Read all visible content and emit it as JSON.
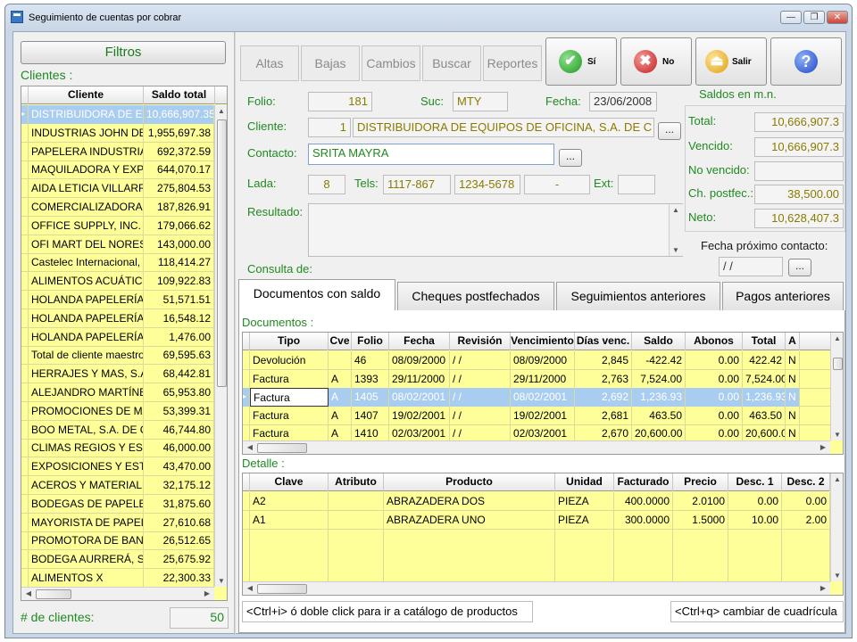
{
  "window": {
    "title": "Seguimiento de cuentas por cobrar",
    "min": "—",
    "max": "❐",
    "close": "✕"
  },
  "left": {
    "filtros": "Filtros",
    "clientes_label": "Clientes :",
    "headers": [
      "Cliente",
      "Saldo total"
    ],
    "rows": [
      [
        "DISTRIBUIDORA DE EQUIP",
        "10,666,907.35"
      ],
      [
        "INDUSTRIAS JOHN DEERE",
        "1,955,697.38"
      ],
      [
        "PAPELERA INDUSTRIAL, S",
        "692,372.59"
      ],
      [
        "MAQUILADORA Y EXPORT",
        "644,070.17"
      ],
      [
        "AIDA LETICIA VILLARREAL",
        "275,804.53"
      ],
      [
        "COMERCIALIZADORA DE",
        "187,826.91"
      ],
      [
        "OFFICE SUPPLY, INC.",
        "179,066.62"
      ],
      [
        "OFI MART DEL NORESTE,",
        "143,000.00"
      ],
      [
        "Castelec Internacional, S.A.",
        "118,414.27"
      ],
      [
        "ALIMENTOS ACUÁTICOS",
        "109,922.83"
      ],
      [
        "HOLANDA PAPELERÍAS C",
        "51,571.51"
      ],
      [
        "HOLANDA PAPELERÍAS D",
        "16,548.12"
      ],
      [
        "HOLANDA PAPELERÍAS D",
        "1,476.00"
      ],
      [
        "Total de cliente maestro HO",
        "69,595.63"
      ],
      [
        "HERRAJES Y MAS, S.A. D",
        "68,442.81"
      ],
      [
        "ALEJANDRO MARTÍNEZ S",
        "65,953.80"
      ],
      [
        "PROMOCIONES DE MADE",
        "53,399.31"
      ],
      [
        "BOO METAL, S.A. DE C.V.",
        "46,744.80"
      ],
      [
        "CLIMAS REGIOS Y ESPEC",
        "46,000.00"
      ],
      [
        "EXPOSICIONES Y ESTANT",
        "43,470.00"
      ],
      [
        "ACEROS Y MATERIALES C",
        "32,175.12"
      ],
      [
        "BODEGAS DE PAPELES Y",
        "31,875.60"
      ],
      [
        "MAYORISTA DE PAPELES",
        "27,610.68"
      ],
      [
        "PROMOTORA DE BANDAS",
        "26,512.65"
      ],
      [
        "BODEGA AURRERÁ, S.A.",
        "25,675.92"
      ],
      [
        "ALIMENTOS X",
        "22,300.33"
      ]
    ],
    "num_clientes_label": "# de clientes:",
    "num_clientes": "50"
  },
  "toolbar": {
    "altas": "Altas",
    "bajas": "Bajas",
    "cambios": "Cambios",
    "buscar": "Buscar",
    "reportes": "Reportes",
    "si": "Sí",
    "no": "No",
    "salir": "Salir",
    "si_icon": "✔",
    "no_icon": "✖",
    "salir_icon": "⏏",
    "help_icon": "?"
  },
  "form": {
    "folio_label": "Folio:",
    "folio": "181",
    "suc_label": "Suc:",
    "suc": "MTY",
    "fecha_label": "Fecha:",
    "fecha": "23/06/2008",
    "cliente_label": "Cliente:",
    "cliente_num": "1",
    "cliente_name": "DISTRIBUIDORA DE EQUIPOS DE OFICINA, S.A. DE C",
    "contacto_label": "Contacto:",
    "contacto": "SRITA MAYRA",
    "lada_label": "Lada:",
    "lada": "8",
    "tels_label": "Tels:",
    "tel1": "1117-867",
    "tel2": "1234-5678",
    "tel3": "-",
    "ext_label": "Ext:",
    "ext": "",
    "resultado_label": "Resultado:",
    "resultado": "",
    "consulta_label": "Consulta de:",
    "ellipsis": "..."
  },
  "saldos": {
    "title": "Saldos en m.n.",
    "total_label": "Total:",
    "total": "10,666,907.3",
    "vencido_label": "Vencido:",
    "vencido": "10,666,907.3",
    "novencido_label": "No vencido:",
    "novencido": "",
    "postfec_label": "Ch. postfec.:",
    "postfec": "38,500.00",
    "neto_label": "Neto:",
    "neto": "10,628,407.3",
    "fpc_label": "Fecha próximo contacto:",
    "fpc": " /  /"
  },
  "tabs": [
    "Documentos con saldo",
    "Cheques postfechados",
    "Seguimientos anteriores",
    "Pagos anteriores"
  ],
  "documentos": {
    "label": "Documentos :",
    "headers": [
      "Tipo",
      "Cve",
      "Folio",
      "Fecha",
      "Revisión",
      "Vencimiento",
      "Días venc.",
      "Saldo",
      "Abonos",
      "Total",
      "A"
    ],
    "rows": [
      [
        "Devolución",
        "",
        "46",
        "08/09/2000",
        " /  /",
        "08/09/2000",
        "2,845",
        "-422.42",
        "0.00",
        "422.42",
        "N"
      ],
      [
        "Factura",
        "A",
        "1393",
        "29/11/2000",
        " /  /",
        "29/11/2000",
        "2,763",
        "7,524.00",
        "0.00",
        "7,524.00",
        "N"
      ],
      [
        "Factura",
        "A",
        "1405",
        "08/02/2001",
        " /  /",
        "08/02/2001",
        "2,692",
        "1,236.93",
        "0.00",
        "1,236.93",
        "N"
      ],
      [
        "Factura",
        "A",
        "1407",
        "19/02/2001",
        " /  /",
        "19/02/2001",
        "2,681",
        "463.50",
        "0.00",
        "463.50",
        "N"
      ],
      [
        "Factura",
        "A",
        "1410",
        "02/03/2001",
        " /  /",
        "02/03/2001",
        "2,670",
        "20,600.00",
        "0.00",
        "20,600.00",
        "N"
      ]
    ]
  },
  "detalle": {
    "label": "Detalle :",
    "headers": [
      "Clave",
      "Atributo",
      "Producto",
      "Unidad",
      "Facturado",
      "Precio",
      "Desc. 1",
      "Desc. 2"
    ],
    "rows": [
      [
        "A2",
        "",
        "ABRAZADERA DOS",
        "PIEZA",
        "400.0000",
        "2.0100",
        "0.00",
        "0.00"
      ],
      [
        "A1",
        "",
        "ABRAZADERA UNO",
        "PIEZA",
        "300.0000",
        "1.5000",
        "10.00",
        "2.00"
      ]
    ]
  },
  "status": {
    "left": "<Ctrl+i> ó doble click para ir a catálogo de productos",
    "right": "<Ctrl+q> cambiar de cuadrícula"
  }
}
